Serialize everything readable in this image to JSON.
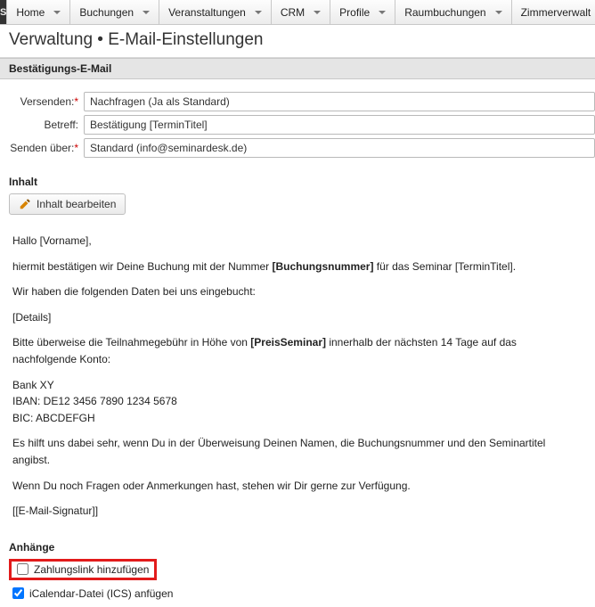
{
  "nav": {
    "logo": "S",
    "items": [
      {
        "label": "Home",
        "has_menu": true
      },
      {
        "label": "Buchungen",
        "has_menu": true
      },
      {
        "label": "Veranstaltungen",
        "has_menu": true
      },
      {
        "label": "CRM",
        "has_menu": true
      },
      {
        "label": "Profile",
        "has_menu": true
      },
      {
        "label": "Raumbuchungen",
        "has_menu": true
      },
      {
        "label": "Zimmerverwalt",
        "has_menu": false
      }
    ]
  },
  "page_title": "Verwaltung • E-Mail-Einstellungen",
  "section_title": "Bestätigungs-E-Mail",
  "form": {
    "send_label": "Versenden:",
    "send_value": "Nachfragen (Ja als Standard)",
    "subject_label": "Betreff:",
    "subject_value": "Bestätigung [TerminTitel]",
    "via_label": "Senden über:",
    "via_value": "Standard (info@seminardesk.de)"
  },
  "content": {
    "heading": "Inhalt",
    "edit_btn": "Inhalt bearbeiten",
    "greeting": "Hallo [Vorname],",
    "line_confirm_a": "hiermit bestätigen wir Deine Buchung mit der Nummer ",
    "line_confirm_b": "[Buchungsnummer]",
    "line_confirm_c": " für das Seminar [TerminTitel].",
    "line_data": "Wir haben die folgenden Daten bei uns eingebucht:",
    "details": "[Details]",
    "line_pay_a": "Bitte überweise die Teilnahmegebühr in Höhe von ",
    "line_pay_b": "[PreisSeminar]",
    "line_pay_c": " innerhalb der nächsten 14 Tage auf das nachfolgende Konto:",
    "bank_name": "Bank XY",
    "iban": "IBAN: DE12 3456 7890 1234 5678",
    "bic": "BIC: ABCDEFGH",
    "line_help": "Es hilft uns dabei sehr, wenn Du in der Überweisung Deinen Namen, die Buchungsnummer und den Seminartitel angibst.",
    "line_questions": "Wenn Du noch Fragen oder Anmerkungen hast, stehen wir Dir gerne zur Verfügung.",
    "signature": "[[E-Mail-Signatur]]"
  },
  "attachments": {
    "heading": "Anhänge",
    "paylink_label": "Zahlungslink hinzufügen",
    "paylink_checked": false,
    "ics_label": "iCalendar-Datei (ICS) anfügen",
    "ics_checked": true
  }
}
